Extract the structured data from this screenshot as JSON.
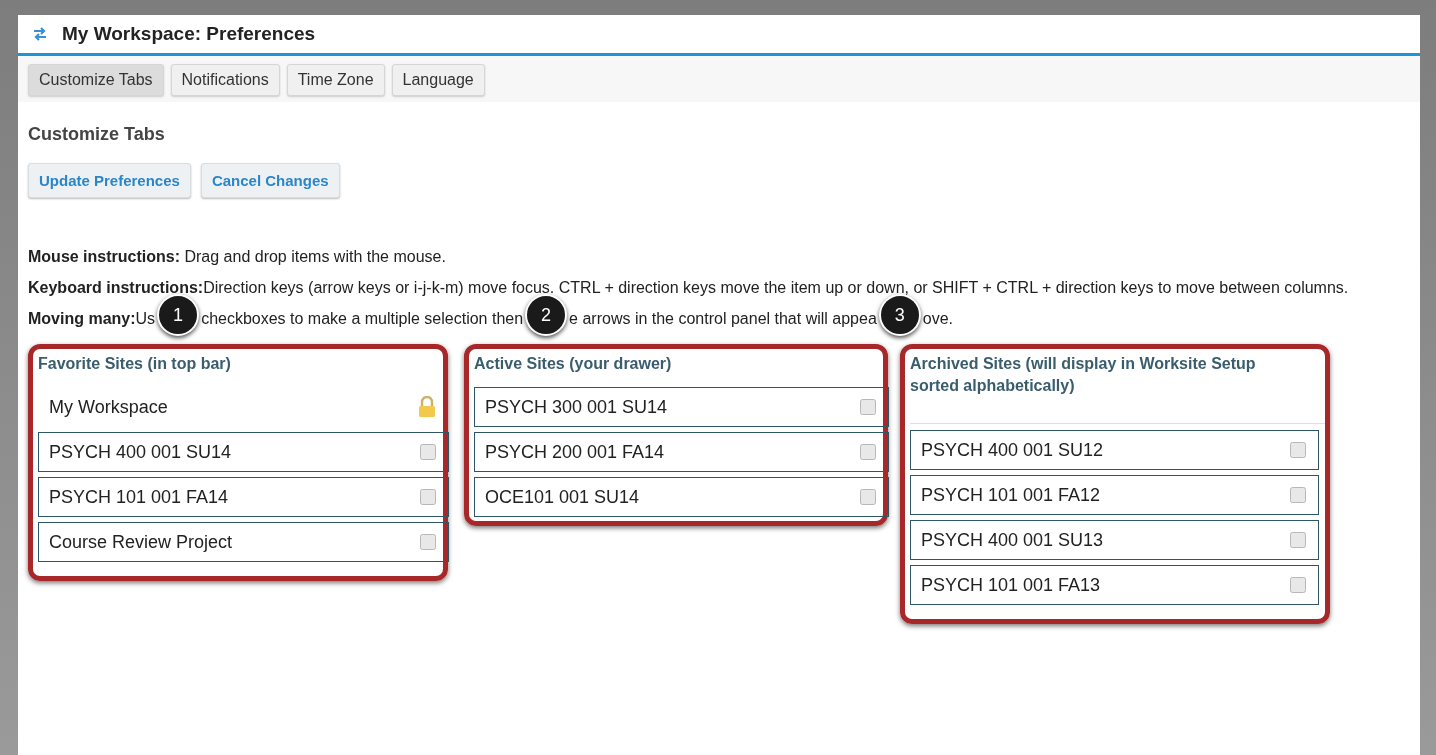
{
  "window": {
    "title": "My Workspace: Preferences"
  },
  "tabs": [
    {
      "label": "Customize Tabs",
      "selected": true
    },
    {
      "label": "Notifications",
      "selected": false
    },
    {
      "label": "Time Zone",
      "selected": false
    },
    {
      "label": "Language",
      "selected": false
    }
  ],
  "heading": "Customize Tabs",
  "buttons": [
    "Update Preferences",
    "Cancel Changes"
  ],
  "instructions": [
    {
      "label": "Mouse instructions:",
      "text": " Drag and drop items with the mouse."
    },
    {
      "label": "Keyboard instructions:",
      "text": "Direction keys (arrow keys or i-j-k-m) move focus. CTRL + direction keys move the item up or down, or SHIFT + CTRL + direction keys to move between columns."
    }
  ],
  "moving_many": {
    "label": "Moving many:",
    "segments": [
      {
        "kind": "text",
        "text": "Us"
      },
      {
        "kind": "callout",
        "text": "1"
      },
      {
        "kind": "text",
        "text": "checkboxes to make a multiple selection then"
      },
      {
        "kind": "callout",
        "text": "2"
      },
      {
        "kind": "text",
        "text": "e arrows in the control panel that will appea"
      },
      {
        "kind": "callout",
        "text": "3"
      },
      {
        "kind": "text",
        "text": "ove."
      }
    ]
  },
  "columns": [
    {
      "title": "Favorite Sites (in top bar)",
      "sites": [
        {
          "name": "My Workspace",
          "locked": true
        },
        {
          "name": "PSYCH 400 001 SU14",
          "locked": false,
          "checked": false
        },
        {
          "name": "PSYCH 101 001 FA14",
          "locked": false,
          "checked": false
        },
        {
          "name": "Course Review Project",
          "locked": false,
          "checked": false
        }
      ]
    },
    {
      "title": "Active Sites (your drawer)",
      "sites": [
        {
          "name": "PSYCH 300 001 SU14",
          "locked": false,
          "checked": false
        },
        {
          "name": "PSYCH 200 001 FA14",
          "locked": false,
          "checked": false
        },
        {
          "name": "OCE101 001 SU14",
          "locked": false,
          "checked": false
        }
      ]
    },
    {
      "title": "Archived Sites (will display in Worksite Setup sorted alphabetically)",
      "sites": [
        {
          "name": "PSYCH 400 001 SU12",
          "locked": false,
          "checked": false
        },
        {
          "name": "PSYCH 101 001 FA12",
          "locked": false,
          "checked": false
        },
        {
          "name": "PSYCH 400 001 SU13",
          "locked": false,
          "checked": false
        },
        {
          "name": "PSYCH 101 001 FA13",
          "locked": false,
          "checked": false
        }
      ]
    }
  ]
}
